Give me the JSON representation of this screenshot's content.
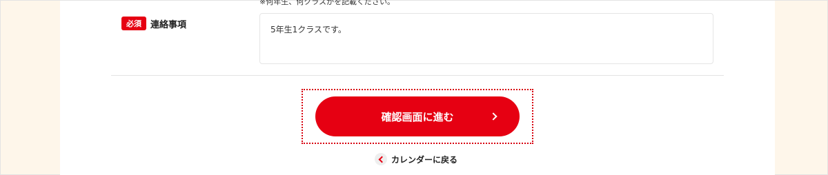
{
  "form": {
    "note": "※何年生、何クラスかを記載ください。",
    "field": {
      "required_badge": "必須",
      "label": "連絡事項",
      "value": "5年生1クラスです。"
    }
  },
  "actions": {
    "submit_label": "確認画面に進む",
    "back_label": "カレンダーに戻る"
  },
  "colors": {
    "accent": "#e60012",
    "side_background": "#fef6ea"
  },
  "icons": {
    "submit": "chevron-right-icon",
    "back": "chevron-left-icon"
  }
}
